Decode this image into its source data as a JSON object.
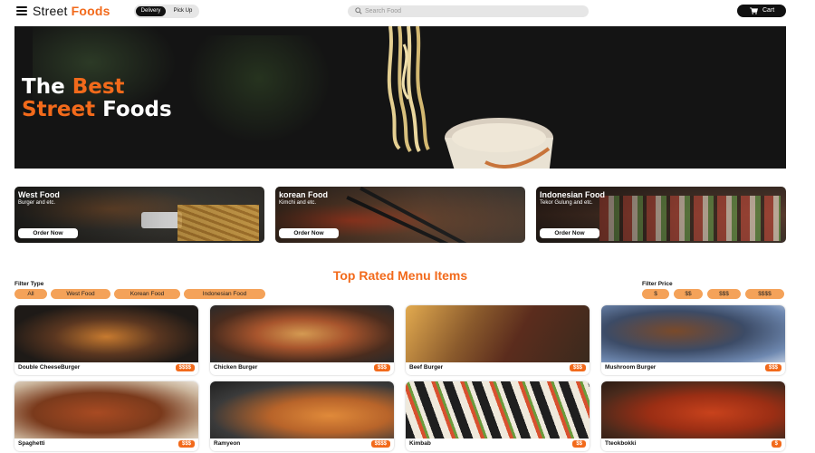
{
  "header": {
    "brand_part1": "Street",
    "brand_part2": "Foods",
    "toggle_active": "Delivery",
    "toggle_inactive": "Pick Up",
    "search_placeholder": "Search Food",
    "cart_label": "Cart"
  },
  "hero": {
    "line1_white": "The",
    "line1_orange": "Best",
    "line2_orange": "Street",
    "line2_white": "Foods"
  },
  "categories": [
    {
      "title": "West Food",
      "subtitle": "Burger and etc.",
      "button": "Order Now"
    },
    {
      "title": "korean Food",
      "subtitle": "Kimchi and etc.",
      "button": "Order Now"
    },
    {
      "title": "Indonesian Food",
      "subtitle": "Tekor Gulung and etc.",
      "button": "Order Now"
    }
  ],
  "menu": {
    "title": "Top Rated Menu Items",
    "filter_type_label": "Filter Type",
    "filter_types": [
      "All",
      "West Food",
      "Korean Food",
      "Indonesian Food"
    ],
    "filter_price_label": "Filter Price",
    "filter_prices": [
      "$",
      "$$",
      "$$$",
      "$$$$"
    ],
    "items": [
      {
        "name": "Double CheeseBurger",
        "price": "$$$$"
      },
      {
        "name": "Chicken Burger",
        "price": "$$$"
      },
      {
        "name": "Beef Burger",
        "price": "$$$"
      },
      {
        "name": "Mushroom Burger",
        "price": "$$$"
      },
      {
        "name": "Spaghetti",
        "price": "$$$"
      },
      {
        "name": "Ramyeon",
        "price": "$$$$"
      },
      {
        "name": "Kimbab",
        "price": "$$"
      },
      {
        "name": "Tteokbokki",
        "price": "$"
      }
    ]
  },
  "colors": {
    "accent": "#f26a1b",
    "chip": "#f4a259",
    "dark": "#111111"
  }
}
